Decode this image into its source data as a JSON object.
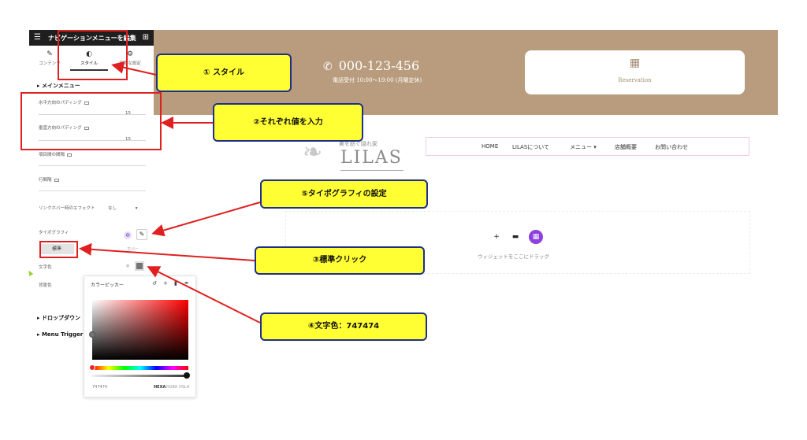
{
  "editor": {
    "panel_title": "ナビゲーションメニューを編集",
    "tabs": [
      {
        "label": "コンテンツ",
        "icon": "pencil-icon"
      },
      {
        "label": "スタイル",
        "icon": "half-circle-icon"
      },
      {
        "label": "高度な設定",
        "icon": "gear-icon"
      }
    ],
    "section_main_menu": "メインメニュー",
    "controls": {
      "h_padding_label": "水平方向のパディング",
      "h_padding_value": "15",
      "v_padding_label": "垂直方向のパディング",
      "v_padding_value": "15",
      "item_spacing_label": "項目間の間隔",
      "line_height_label": "行間隔",
      "hover_effect_label": "リンクホバー時のエフェクト",
      "hover_effect_value": "なし",
      "typography_label": "タイポグラフィ",
      "normal_tab": "標準",
      "hover_tab_hint": "ホバー",
      "text_color_label": "文字色",
      "bg_color_label": "背景色"
    },
    "section_dropdown": "ドロップダウン",
    "section_menu_trigger": "Menu Trigger &"
  },
  "color_picker": {
    "title": "カラーピッカー",
    "hex_value": "747474",
    "modes": [
      "HEXA",
      "RGBA",
      "HSLA"
    ],
    "selected_color": "#747474"
  },
  "preview": {
    "phone": "000-123-456",
    "hours": "電話受付 10:00～19:00 (月曜定休)",
    "reservation_label": "Reservation",
    "logo_tagline": "美を紡ぐ隠れ家",
    "logo_name": "LILAS",
    "nav_items": [
      "HOME",
      "LILASについて",
      "メニュー",
      "店舗概要",
      "お問い合わせ"
    ],
    "dropzone_text": "ウィジェットをここにドラッグ"
  },
  "annotations": {
    "step1": "① スタイル",
    "step2": "②それぞれ値を入力",
    "step3": "③標準クリック",
    "step4": "④文字色：747474",
    "step5": "⑤タイポグラフィの設定"
  },
  "colors": {
    "banner": "#b99c7e",
    "callout_fill": "#ffff33",
    "callout_border": "#1e2f86",
    "highlight_red": "#e02020",
    "accent_purple": "#8d40e0"
  }
}
